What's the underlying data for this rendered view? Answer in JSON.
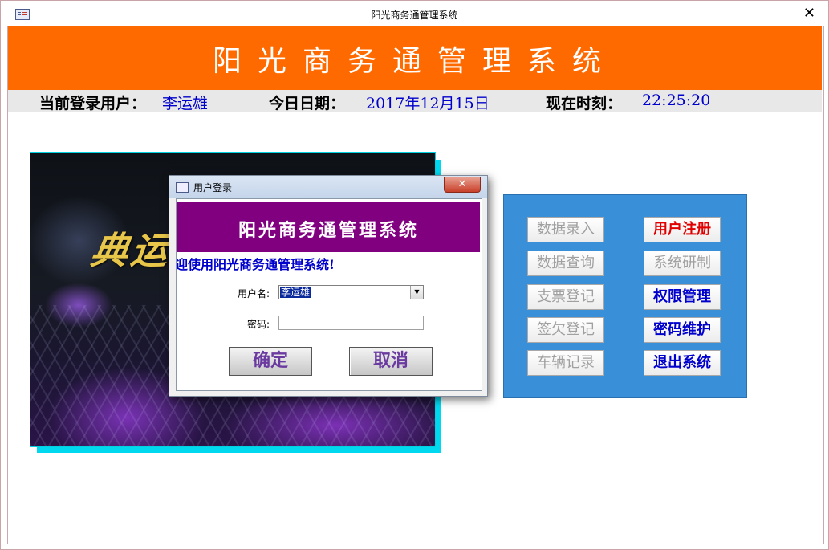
{
  "window": {
    "title": "阳光商务通管理系统",
    "close_label": "✕"
  },
  "banner": {
    "title": "阳光商务通管理系统"
  },
  "status": {
    "user_label": "当前登录用户：",
    "user_value": "李运雄",
    "date_label": "今日日期：",
    "date_value": "2017年12月15日",
    "time_label": "现在时刻：",
    "time_value": "22:25:20"
  },
  "image": {
    "caption": "典运"
  },
  "menu": {
    "data_entry": "数据录入",
    "data_query": "数据查询",
    "check_register": "支票登记",
    "debt_register": "签欠登记",
    "vehicle_record": "车辆记录",
    "user_register": "用户注册",
    "system_dev": "系统研制",
    "permission_mgmt": "权限管理",
    "password_maint": "密码维护",
    "exit_system": "退出系统"
  },
  "dialog": {
    "title": "用户登录",
    "close_label": "✕",
    "banner": "阳光商务通管理系统",
    "welcome": "迎使用阳光商务通管理系统!",
    "username_label": "用户名:",
    "username_value": "李运雄",
    "password_label": "密码:",
    "ok_label": "确定",
    "cancel_label": "取消"
  },
  "colors": {
    "banner_orange": "#ff6a00",
    "dialog_banner_purple": "#800080",
    "panel_blue": "#3a90d8",
    "accent_cyan": "#00d8f0",
    "value_blue": "#0000cc",
    "highlight_red": "#e00000"
  }
}
